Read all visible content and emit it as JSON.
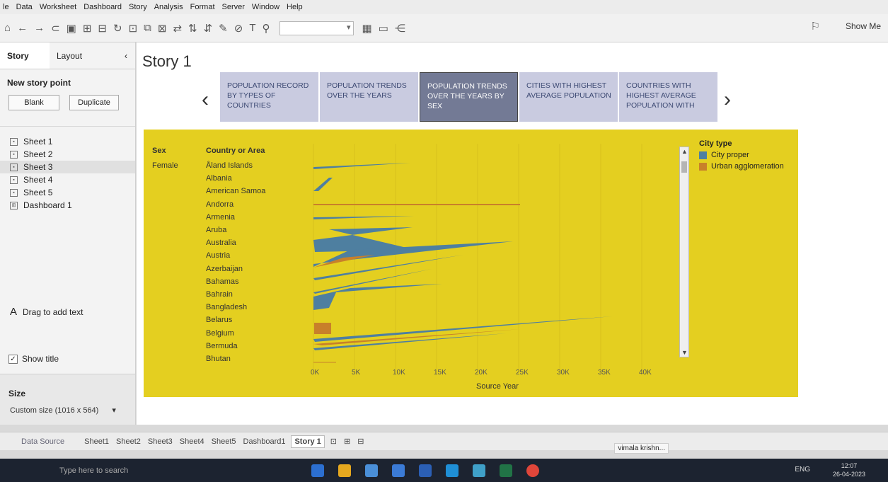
{
  "menubar": {
    "items": [
      "le",
      "Data",
      "Worksheet",
      "Dashboard",
      "Story",
      "Analysis",
      "Format",
      "Server",
      "Window",
      "Help"
    ]
  },
  "toolbar": {
    "show_me": "Show Me"
  },
  "left_pane": {
    "tabs": {
      "story": "Story",
      "layout": "Layout"
    },
    "new_story_point": "New story point",
    "blank": "Blank",
    "duplicate": "Duplicate",
    "sheets": [
      "Sheet 1",
      "Sheet 2",
      "Sheet 3",
      "Sheet 4",
      "Sheet 5",
      "Dashboard 1"
    ],
    "drag_text": "Drag to add text",
    "show_title": "Show title",
    "size_label": "Size",
    "size_value": "Custom size (1016 x 564)"
  },
  "story": {
    "title": "Story 1",
    "points": [
      "POPULATION RECORD BY TYPES OF COUNTRIES",
      "POPULATION TRENDS OVER THE YEARS",
      "POPULATION TRENDS OVER THE YEARS BY SEX",
      "CITIES WITH HIGHEST AVERAGE POPULATION",
      "COUNTRIES WITH HIGHEST AVERAGE POPULATION WITH"
    ],
    "current_index": 2
  },
  "viz": {
    "col_sex": "Sex",
    "col_country": "Country or Area",
    "sex_value": "Female",
    "countries": [
      "Åland Islands",
      "Albania",
      "American Samoa",
      "Andorra",
      "Armenia",
      "Aruba",
      "Australia",
      "Austria",
      "Azerbaijan",
      "Bahamas",
      "Bahrain",
      "Bangladesh",
      "Belarus",
      "Belgium",
      "Bermuda",
      "Bhutan"
    ],
    "x_ticks": [
      "0K",
      "5K",
      "10K",
      "15K",
      "20K",
      "25K",
      "30K",
      "35K",
      "40K"
    ],
    "x_label": "Source Year",
    "legend_title": "City type",
    "legend": [
      {
        "label": "City proper",
        "color": "#4e7fa0"
      },
      {
        "label": "Urban agglomeration",
        "color": "#c8802a"
      }
    ]
  },
  "bottom_tabs": {
    "data_source": "Data Source",
    "tabs": [
      "Sheet1",
      "Sheet2",
      "Sheet3",
      "Sheet4",
      "Sheet5",
      "Dashboard1",
      "Story 1"
    ],
    "active": "Story 1"
  },
  "status": {
    "user": "vimala krishn...",
    "time": "12:07",
    "date": "26-04-2023",
    "lang": "ENG",
    "search": "Type here to search"
  }
}
